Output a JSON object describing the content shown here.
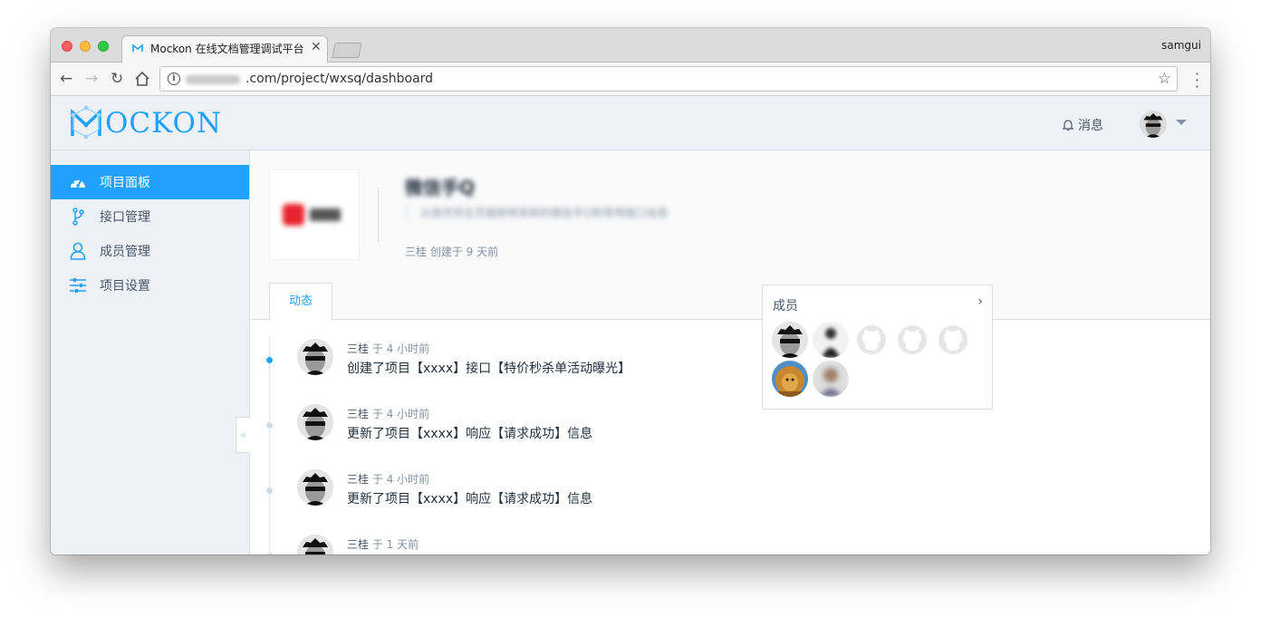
{
  "browser": {
    "tab_title": "Mockon 在线文档管理调试平台",
    "profile_name": "samgui",
    "url_visible": ".com/project/wxsq/dashboard"
  },
  "header": {
    "logo_text": "OCKON",
    "messages_label": "消息"
  },
  "sidebar": {
    "items": [
      {
        "label": "项目面板",
        "icon": "dashboard-icon",
        "active": true
      },
      {
        "label": "接口管理",
        "icon": "api-branch-icon",
        "active": false
      },
      {
        "label": "成员管理",
        "icon": "user-icon",
        "active": false
      },
      {
        "label": "项目设置",
        "icon": "settings-sliders-icon",
        "active": false
      }
    ],
    "collapse_label": "«"
  },
  "project": {
    "name": "微信手Q",
    "description": "从首页到主页面新特发新的微信手Q和常用接口信息",
    "meta": "三桂 创建于 9 天前"
  },
  "tabs": [
    {
      "label": "动态",
      "active": true
    }
  ],
  "timeline": [
    {
      "user": "三桂",
      "time": "于 4 小时前",
      "text": "创建了项目【xxxx】接口【特价秒杀单活动曝光】",
      "active": true
    },
    {
      "user": "三桂",
      "time": "于 4 小时前",
      "text": "更新了项目【xxxx】响应【请求成功】信息",
      "active": false
    },
    {
      "user": "三桂",
      "time": "于 4 小时前",
      "text": "更新了项目【xxxx】响应【请求成功】信息",
      "active": false
    },
    {
      "user": "三桂",
      "time": "于 1 天前",
      "text": "",
      "active": false
    }
  ],
  "members": {
    "title": "成员",
    "arrow": "›",
    "count": 7
  },
  "colors": {
    "accent": "#20a0ff",
    "sidebar_bg": "#eef1f6",
    "text_primary": "#1f2d3d",
    "text_secondary": "#8391a5"
  }
}
